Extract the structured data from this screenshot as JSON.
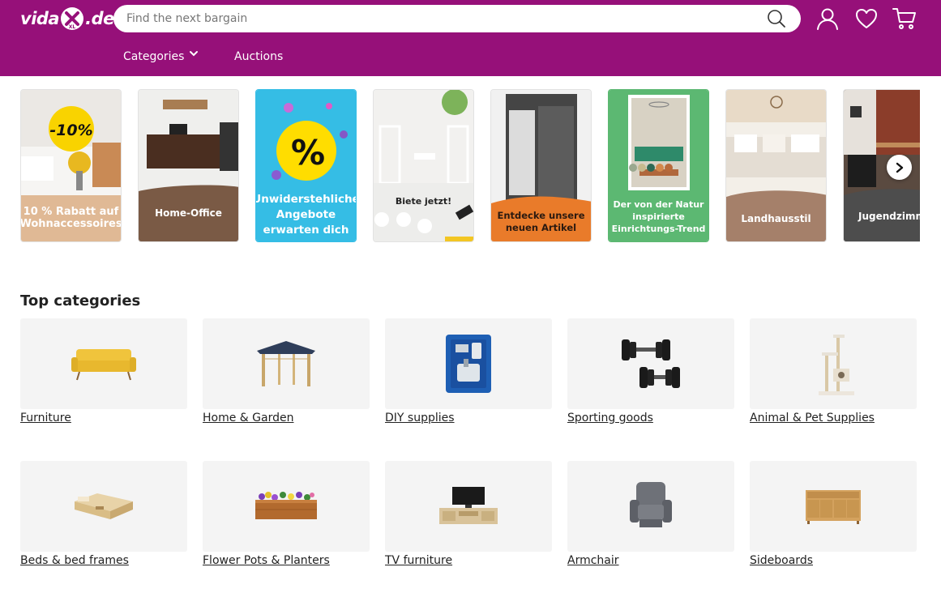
{
  "header": {
    "logo": {
      "text_left": "vida",
      "text_badge": "XL",
      "text_right": ".de"
    },
    "search": {
      "placeholder": "Find the next bargain"
    },
    "icons": [
      "account-icon",
      "heart-icon",
      "cart-icon"
    ],
    "nav": {
      "categories": "Categories",
      "auctions": "Auctions"
    }
  },
  "colors": {
    "brand": "#961079",
    "tile_bg": "#f4f4f4"
  },
  "banners": [
    {
      "caption": "10 % Rabatt auf Wohnaccessoires",
      "badge": "-10%"
    },
    {
      "caption": "Home-Office"
    },
    {
      "caption": "Unwiderstehliche Angebote erwarten dich",
      "badge": "%"
    },
    {
      "caption": "Biete jetzt!"
    },
    {
      "caption": "Entdecke unsere neuen Artikel"
    },
    {
      "caption": "Der von der Natur inspirierte Einrichtungs-Trend"
    },
    {
      "caption": "Landhausstil"
    },
    {
      "caption": "Jugendzimmer"
    }
  ],
  "top_categories": {
    "title": "Top categories",
    "items": [
      {
        "label": "Furniture",
        "icon": "sofa-icon"
      },
      {
        "label": "Home & Garden",
        "icon": "gazebo-icon"
      },
      {
        "label": "DIY supplies",
        "icon": "spray-gun-case-icon"
      },
      {
        "label": "Sporting goods",
        "icon": "dumbbells-icon"
      },
      {
        "label": "Animal & Pet Supplies",
        "icon": "cat-tree-icon"
      },
      {
        "label": "Beds & bed frames",
        "icon": "bed-frame-icon"
      },
      {
        "label": "Flower Pots & Planters",
        "icon": "planter-icon"
      },
      {
        "label": "TV furniture",
        "icon": "tv-stand-icon"
      },
      {
        "label": "Armchair",
        "icon": "armchair-icon"
      },
      {
        "label": "Sideboards",
        "icon": "sideboard-icon"
      }
    ]
  }
}
